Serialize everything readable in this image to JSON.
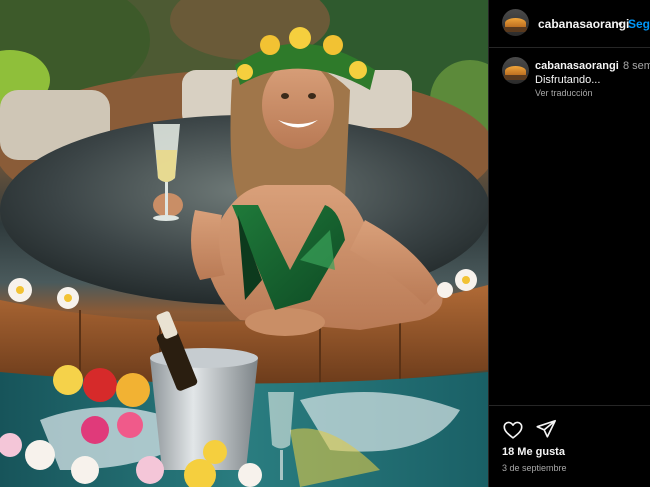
{
  "post": {
    "image_alt": "Woman in a green swimsuit with a flower crown holding a glass of champagne in a wooden hot tub"
  },
  "header": {
    "username": "cabanasaorangi",
    "separator": "•",
    "follow_label": "Seg"
  },
  "caption": {
    "username": "cabanasaorangi",
    "time": "8 sem",
    "text": "Disfrutando...",
    "translate_label": "Ver traducción"
  },
  "actions": {
    "like_icon": "heart-icon",
    "share_icon": "send-icon",
    "likes_text": "18 Me gusta",
    "date_text": "3 de septiembre"
  },
  "colors": {
    "background": "#000000",
    "text": "#f5f5f5",
    "muted": "#a8a8a8",
    "link": "#0095f6",
    "divider": "#262626"
  }
}
